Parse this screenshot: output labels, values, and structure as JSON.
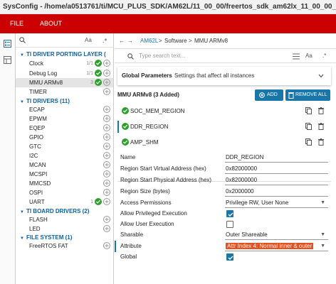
{
  "window": {
    "title": "SysConfig - /home/a0513761/ti/MCU_PLUS_SDK/AM62L/11_00_00/freertos_sdk_am62lx_11_00_00_05/example"
  },
  "menu": {
    "file": "FILE",
    "about": "ABOUT"
  },
  "sidebar_icons": [
    "list-icon",
    "grid-icon"
  ],
  "left_panel": {
    "search_aa": "Aa",
    "sections": [
      {
        "label": "TI DRIVER PORTING LAYER (",
        "items": [
          {
            "name": "Clock",
            "count": "1/1",
            "added": true,
            "selected": false
          },
          {
            "name": "Debug Log",
            "count": "1/1",
            "added": true,
            "selected": false
          },
          {
            "name": "MMU ARMv8",
            "count": "3",
            "added": true,
            "selected": true
          },
          {
            "name": "TIMER",
            "count": "",
            "added": false,
            "selected": false
          }
        ]
      },
      {
        "label": "TI DRIVERS (11)",
        "items": [
          {
            "name": "ECAP",
            "count": "",
            "added": false
          },
          {
            "name": "EPWM",
            "count": "",
            "added": false
          },
          {
            "name": "EQEP",
            "count": "",
            "added": false
          },
          {
            "name": "GPIO",
            "count": "",
            "added": false
          },
          {
            "name": "GTC",
            "count": "",
            "added": false
          },
          {
            "name": "I2C",
            "count": "",
            "added": false
          },
          {
            "name": "MCAN",
            "count": "",
            "added": false
          },
          {
            "name": "MCSPI",
            "count": "",
            "added": false
          },
          {
            "name": "MMCSD",
            "count": "",
            "added": false
          },
          {
            "name": "OSPI",
            "count": "",
            "added": false
          },
          {
            "name": "UART",
            "count": "1",
            "added": true
          }
        ]
      },
      {
        "label": "TI BOARD DRIVERS (2)",
        "items": [
          {
            "name": "FLASH",
            "count": "",
            "added": false
          },
          {
            "name": "LED",
            "count": "",
            "added": false
          }
        ]
      },
      {
        "label": "FILE SYSTEM (1)",
        "items": [
          {
            "name": "FreeRTOS FAT",
            "count": "",
            "added": false
          }
        ]
      }
    ]
  },
  "navbar": {
    "device": "AM62L",
    "sep1": ">",
    "category": "Software",
    "sep2": ">",
    "module": "MMU ARMv8"
  },
  "search": {
    "placeholder": "Type search text...",
    "aa": "Aa"
  },
  "global_params": {
    "label": "Global Parameters",
    "description": "Settings that affect all instances"
  },
  "instances_header": {
    "title": "MMU ARMv8 (3 Added)",
    "add_label": "ADD",
    "remove_all_label": "REMOVE ALL"
  },
  "instances": [
    {
      "name": "SOC_MEM_REGION",
      "selected": false
    },
    {
      "name": "DDR_REGION",
      "selected": true
    },
    {
      "name": "AMP_SHM",
      "selected": false
    }
  ],
  "properties": {
    "name": {
      "label": "Name",
      "value": "DDR_REGION"
    },
    "virt_addr": {
      "label": "Region Start Virtual Address (hex)",
      "value": "0x82000000"
    },
    "phys_addr": {
      "label": "Region Start Physical Address (hex)",
      "value": "0x82000000"
    },
    "size": {
      "label": "Region Size (bytes)",
      "value": "0x2000000"
    },
    "access": {
      "label": "Access Permissions",
      "value": "Privilege RW, User None"
    },
    "priv_exec": {
      "label": "Allow Privileged Execution",
      "checked": true
    },
    "user_exec": {
      "label": "Allow User Execution",
      "checked": false
    },
    "shareable": {
      "label": "Sharable",
      "value": "Outer Shareable"
    },
    "attribute": {
      "label": "Attribute",
      "value": "Attr Index 4: Normal inner & outer"
    },
    "global": {
      "label": "Global",
      "checked": true
    }
  },
  "colors": {
    "menubar": "#cc0000",
    "accent": "#1976a8",
    "check": "#2ca02c",
    "highlight": "#e8501f"
  }
}
